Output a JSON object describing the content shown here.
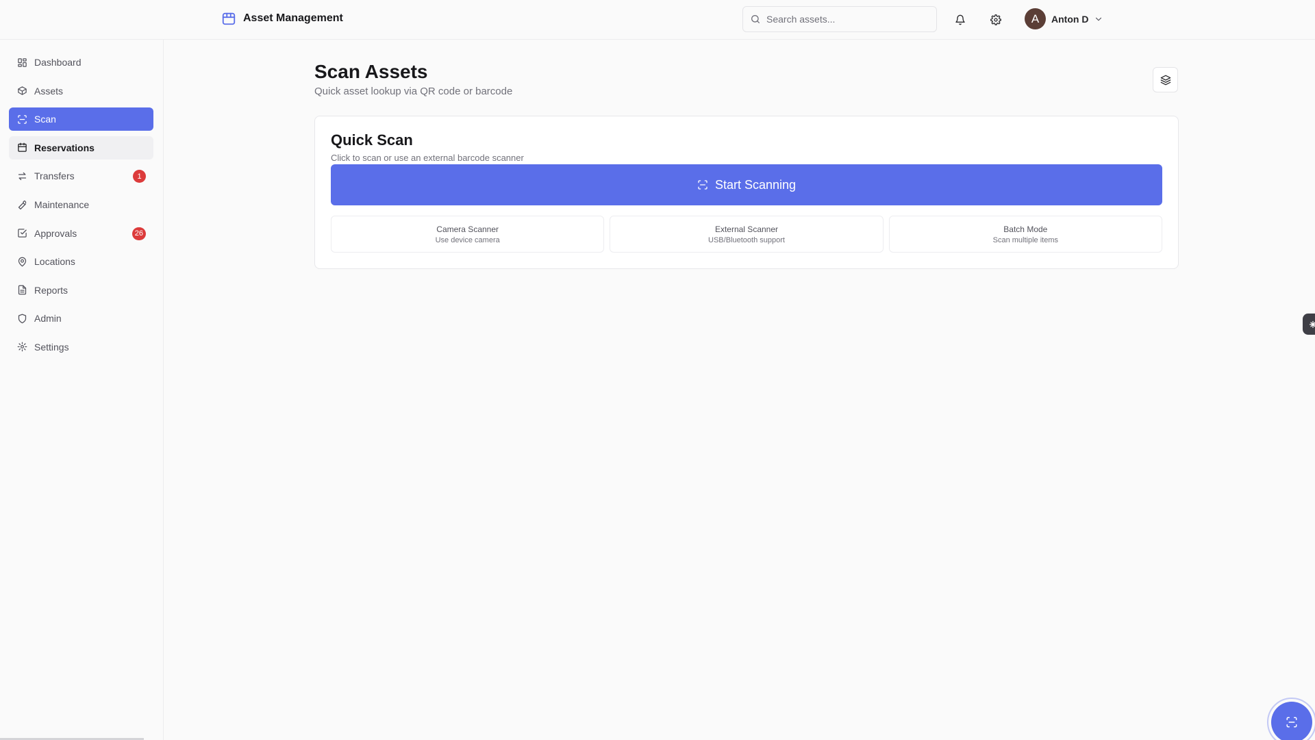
{
  "header": {
    "app_title": "Asset Management",
    "search_placeholder": "Search assets...",
    "user_initial": "A",
    "user_name": "Anton D"
  },
  "sidebar": {
    "items": [
      {
        "label": "Dashboard",
        "icon": "dashboard-icon"
      },
      {
        "label": "Assets",
        "icon": "box-icon"
      },
      {
        "label": "Scan",
        "icon": "scan-icon",
        "active": true
      },
      {
        "label": "Reservations",
        "icon": "calendar-icon",
        "hover": true
      },
      {
        "label": "Transfers",
        "icon": "transfer-icon",
        "badge": "1"
      },
      {
        "label": "Maintenance",
        "icon": "wrench-icon"
      },
      {
        "label": "Approvals",
        "icon": "check-square-icon",
        "badge": "26"
      },
      {
        "label": "Locations",
        "icon": "map-pin-icon"
      },
      {
        "label": "Reports",
        "icon": "file-icon"
      },
      {
        "label": "Admin",
        "icon": "shield-icon"
      },
      {
        "label": "Settings",
        "icon": "gear-icon"
      }
    ]
  },
  "main": {
    "title": "Scan Assets",
    "subtitle": "Quick asset lookup via QR code or barcode",
    "card": {
      "title": "Quick Scan",
      "description": "Click to scan or use an external barcode scanner",
      "button_label": "Start Scanning",
      "options": [
        {
          "title": "Camera Scanner",
          "subtitle": "Use device camera"
        },
        {
          "title": "External Scanner",
          "subtitle": "USB/Bluetooth support"
        },
        {
          "title": "Batch Mode",
          "subtitle": "Scan multiple items"
        }
      ]
    }
  },
  "colors": {
    "accent": "#5a6ee9",
    "badge": "#dc3b3b",
    "avatar": "#5b3e36"
  }
}
